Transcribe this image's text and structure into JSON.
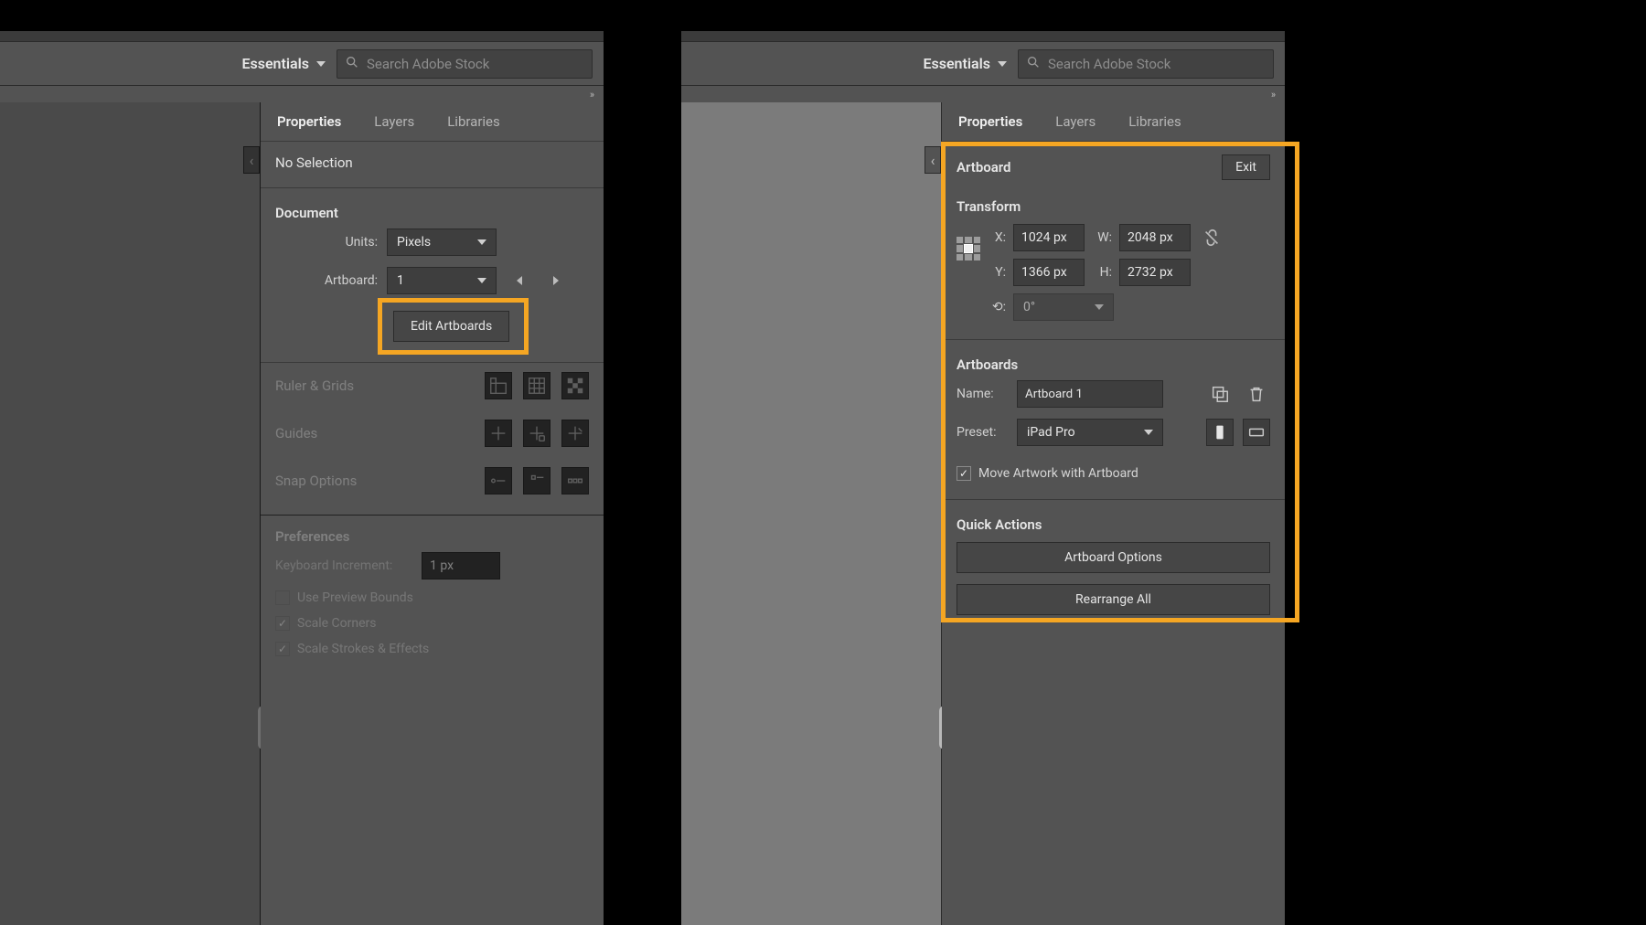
{
  "topbar": {
    "workspace": "Essentials",
    "search_placeholder": "Search Adobe Stock"
  },
  "tabs": {
    "properties": "Properties",
    "layers": "Layers",
    "libraries": "Libraries"
  },
  "left": {
    "selection_state": "No Selection",
    "document": {
      "heading": "Document",
      "units_label": "Units:",
      "units_value": "Pixels",
      "artboard_label": "Artboard:",
      "artboard_value": "1",
      "edit_artboards_btn": "Edit Artboards"
    },
    "sections": {
      "ruler_grids": "Ruler & Grids",
      "guides": "Guides",
      "snap": "Snap Options",
      "preferences": "Preferences"
    },
    "prefs": {
      "kbd_incr_label": "Keyboard Increment:",
      "kbd_incr_value": "1 px",
      "use_preview_bounds": "Use Preview Bounds",
      "scale_corners": "Scale Corners",
      "scale_strokes": "Scale Strokes & Effects"
    }
  },
  "right": {
    "context": "Artboard",
    "exit_btn": "Exit",
    "transform": {
      "heading": "Transform",
      "x_label": "X:",
      "x_value": "1024 px",
      "y_label": "Y:",
      "y_value": "1366 px",
      "w_label": "W:",
      "w_value": "2048 px",
      "h_label": "H:",
      "h_value": "2732 px",
      "rotate_value": "0°"
    },
    "artboards": {
      "heading": "Artboards",
      "name_label": "Name:",
      "name_value": "Artboard 1",
      "preset_label": "Preset:",
      "preset_value": "iPad Pro",
      "move_artwork_label": "Move Artwork with Artboard"
    },
    "quick_actions": {
      "heading": "Quick Actions",
      "artboard_options_btn": "Artboard Options",
      "rearrange_btn": "Rearrange All"
    }
  },
  "colors": {
    "accent": "#f5a623"
  }
}
